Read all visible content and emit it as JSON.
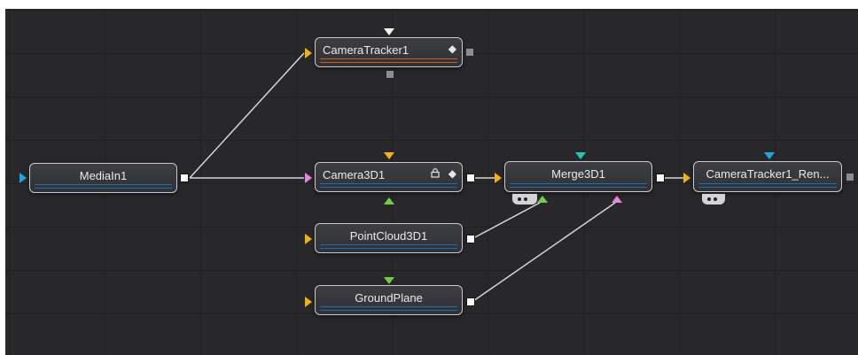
{
  "nodes": {
    "mediain1": {
      "label": "MediaIn1"
    },
    "cameratracker1": {
      "label": "CameraTracker1",
      "icon": "keyframe-diamond-icon"
    },
    "camera3d1": {
      "label": "Camera3D1",
      "icons": [
        "lock-icon",
        "keyframe-diamond-icon"
      ]
    },
    "merge3d1": {
      "label": "Merge3D1"
    },
    "cameratracker1_renderer": {
      "label": "CameraTracker1_Ren..."
    },
    "pointcloud3d1": {
      "label": "PointCloud3D1"
    },
    "groundplane": {
      "label": "GroundPlane"
    }
  },
  "colors": {
    "canvas": "#28282b",
    "node_border": "#c9cace",
    "input_orange": "#f2b10f",
    "input_blue": "#1aa7e8",
    "input_pink": "#e982e0",
    "input_green": "#6fd13c",
    "input_cyan": "#1fc6b9",
    "input_white": "#f2f2f2",
    "bar_blue": "#1b6fb0",
    "bar_orange": "#c45f1e",
    "wire": "#d6d6d6"
  }
}
